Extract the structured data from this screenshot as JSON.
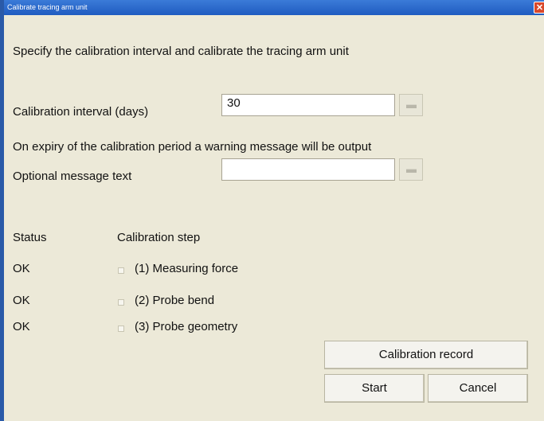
{
  "window": {
    "title": "Calibrate tracing arm unit"
  },
  "intro": "Specify the calibration interval and calibrate the tracing arm unit",
  "interval": {
    "label": "Calibration interval (days)",
    "value": "30"
  },
  "warning_note": "On expiry of the calibration period a warning message will be output",
  "message": {
    "label": "Optional message text",
    "value": ""
  },
  "table": {
    "status_header": "Status",
    "step_header": "Calibration step",
    "rows": [
      {
        "status": "OK",
        "step": "(1)  Measuring force",
        "checked": false
      },
      {
        "status": "OK",
        "step": "(2)  Probe bend",
        "checked": false
      },
      {
        "status": "OK",
        "step": "(3)  Probe geometry",
        "checked": false
      }
    ]
  },
  "buttons": {
    "record": "Calibration record",
    "start": "Start",
    "cancel": "Cancel"
  },
  "icons": {
    "close": "close-icon",
    "keyboard": "keyboard-icon",
    "checkbox": "checkbox-icon"
  },
  "colors": {
    "title_bar": "#1f5bc0",
    "window_bg": "#ece9d8",
    "close": "#d9482b"
  }
}
